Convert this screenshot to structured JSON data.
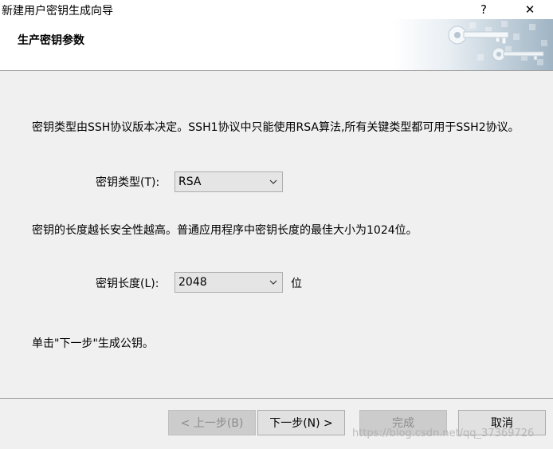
{
  "window": {
    "title": "新建用户密钥生成向导",
    "help_glyph": "?",
    "close_glyph": "✕"
  },
  "header": {
    "title": "生产密钥参数"
  },
  "content": {
    "description": "密钥类型由SSH协议版本决定。SSH1协议中只能使用RSA算法,所有关键类型都可用于SSH2协议。",
    "key_type": {
      "label": "密钥类型(T):",
      "value": "RSA"
    },
    "length_description": "密钥的长度越长安全性越高。普通应用程序中密钥长度的最佳大小为1024位。",
    "key_length": {
      "label": "密钥长度(L):",
      "value": "2048",
      "unit": "位"
    },
    "hint": "单击\"下一步\"生成公钥。"
  },
  "footer": {
    "back_label": "< 上一步(B)",
    "next_label": "下一步(N) >",
    "finish_label": "完成",
    "cancel_label": "取消"
  },
  "watermark": "https://blog.csdn.net/qq_37369726",
  "colors": {
    "window_bg": "#f0f0f0",
    "header_bg": "#ffffff",
    "combo_bg": "#e5e5e5",
    "button_bg": "#e1e1e1",
    "disabled_button_bg": "#cccccc"
  }
}
